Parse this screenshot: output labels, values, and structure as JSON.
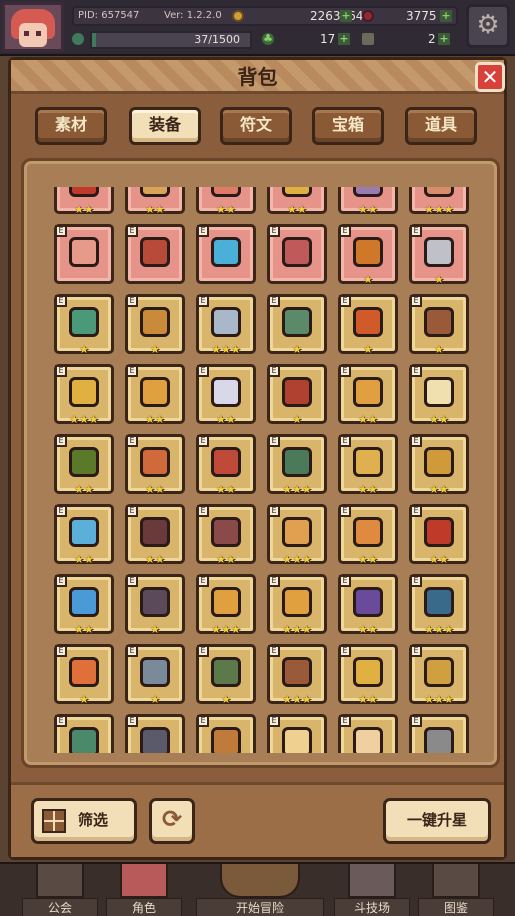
{
  "topbar": {
    "pid": "PID: 657547",
    "version": "Ver: 1.2.2.0",
    "xp_text": "37/1500",
    "xp_progress": 0.0247,
    "coins": "2263164",
    "gems": "3775",
    "clover": "17",
    "key": "2",
    "icons": [
      "gold-coin-icon",
      "red-gem-icon",
      "clover-icon",
      "key-icon",
      "settings-gear-icon"
    ]
  },
  "panel": {
    "title": "背包",
    "close_label": "✕"
  },
  "tabs": [
    {
      "label": "素材",
      "active": false
    },
    {
      "label": "装备",
      "active": true
    },
    {
      "label": "符文",
      "active": false
    },
    {
      "label": "宝箱",
      "active": false
    },
    {
      "label": "道具",
      "active": false
    }
  ],
  "inventory": {
    "tag_letter": "E",
    "rows": [
      {
        "bg": "red",
        "stars": [
          2,
          2,
          2,
          2,
          2,
          3
        ],
        "colors": [
          "#c0392b",
          "#d9a35a",
          "#e07b6a",
          "#e0b040",
          "#9a7ab0",
          "#d98c6a"
        ]
      },
      {
        "bg": "red",
        "stars": [
          0,
          0,
          0,
          0,
          1,
          1
        ],
        "colors": [
          "#e89a8a",
          "#b84a3a",
          "#4ab0d8",
          "#c05a5a",
          "#d0782a",
          "#c0c0c8"
        ]
      },
      {
        "bg": "gold",
        "stars": [
          1,
          1,
          3,
          1,
          1,
          1
        ],
        "colors": [
          "#4a9a7a",
          "#c98a3a",
          "#a8b8c8",
          "#5a8a6a",
          "#d05a2a",
          "#9a5a3a"
        ]
      },
      {
        "bg": "gold",
        "stars": [
          3,
          2,
          2,
          1,
          2,
          2
        ],
        "colors": [
          "#e0b040",
          "#e0a040",
          "#d8d8e8",
          "#b04030",
          "#e0a040",
          "#f0e0b0"
        ]
      },
      {
        "bg": "gold",
        "stars": [
          2,
          2,
          2,
          3,
          2,
          2
        ],
        "colors": [
          "#5a7a2a",
          "#d06a3a",
          "#c04a3a",
          "#4a7a5a",
          "#e0b050",
          "#d09a3a"
        ]
      },
      {
        "bg": "gold",
        "stars": [
          2,
          2,
          2,
          3,
          2,
          2
        ],
        "colors": [
          "#5ab0d8",
          "#6a3a3a",
          "#8a4a4a",
          "#e0a050",
          "#e08a40",
          "#c03a2a"
        ]
      },
      {
        "bg": "gold",
        "stars": [
          2,
          1,
          3,
          3,
          2,
          3
        ],
        "colors": [
          "#4a9ad8",
          "#5a4a5a",
          "#e0a040",
          "#e0a040",
          "#6a4a9a",
          "#3a6a8a"
        ]
      },
      {
        "bg": "gold",
        "stars": [
          1,
          1,
          1,
          3,
          2,
          3
        ],
        "colors": [
          "#e0703a",
          "#7a8a9a",
          "#5a7a4a",
          "#9a5a3a",
          "#e0b040",
          "#d0a040"
        ]
      },
      {
        "bg": "gold",
        "stars": [
          0,
          0,
          0,
          0,
          0,
          0
        ],
        "colors": [
          "#4a8a6a",
          "#5a5a6a",
          "#c07a3a",
          "#f0d090",
          "#f0d0a0",
          "#8a8a8a"
        ]
      }
    ]
  },
  "actions": {
    "filter_label": "筛选",
    "refresh_label": "⟳",
    "star_up_label": "一键升星"
  },
  "nav": [
    {
      "label": "公会"
    },
    {
      "label": "角色"
    },
    {
      "label": "开始冒险"
    },
    {
      "label": "斗技场"
    },
    {
      "label": "图鉴"
    }
  ]
}
